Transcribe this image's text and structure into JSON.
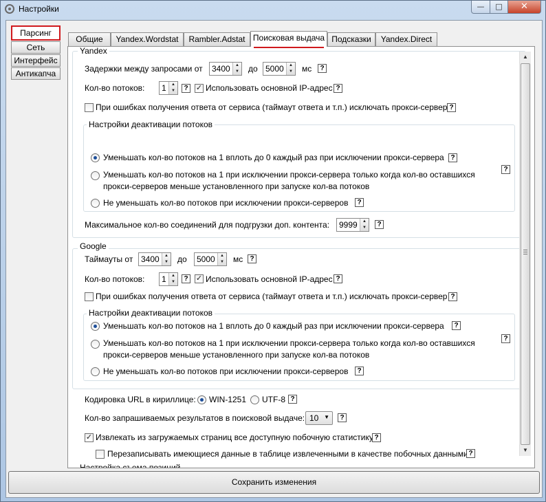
{
  "window": {
    "title": "Настройки",
    "minimize": "—",
    "maximize": "□",
    "close": "✕"
  },
  "left_tabs": [
    "Парсинг",
    "Сеть",
    "Интерфейс",
    "Антикапча"
  ],
  "tabs": [
    "Общие",
    "Yandex.Wordstat",
    "Rambler.Adstat",
    "Поисковая выдача",
    "Подсказки",
    "Yandex.Direct"
  ],
  "help": "?",
  "yandex": {
    "group_title": "Yandex",
    "delay_label": "Задержки между запросами от",
    "delay_from": "3400",
    "to_label": "до",
    "delay_to": "5000",
    "ms_label": "мс",
    "threads_label": "Кол-во потоков:",
    "threads": "1",
    "use_main_ip": "Использовать основной IP-адрес",
    "exclude_proxy": "При ошибках получения ответа от сервиса (таймаут ответа и т.п.) исключать прокси-сервер",
    "deact_title": "Настройки деактивации потоков",
    "opt1": "Уменьшать кол-во потоков на 1 вплоть до 0 каждый раз при исключении прокси-сервера",
    "opt2_line1": "Уменьшать кол-во потоков на 1 при исключении прокси-сервера только когда кол-во оставшихся",
    "opt2_line2": "прокси-серверов меньше установленного при запуске кол-ва потоков",
    "opt3": "Не уменьшать кол-во потоков при исключении прокси-серверов",
    "max_conn_label": "Максимальное кол-во соединений для подгрузки доп. контента:",
    "max_conn": "9999"
  },
  "google": {
    "group_title": "Google",
    "timeout_label": "Таймауты от",
    "timeout_from": "3400",
    "to_label": "до",
    "timeout_to": "5000",
    "ms_label": "мс",
    "threads_label": "Кол-во потоков:",
    "threads": "1",
    "use_main_ip": "Использовать основной IP-адрес",
    "exclude_proxy": "При ошибках получения ответа от сервиса (таймаут ответа и т.п.) исключать прокси-сервер",
    "deact_title": "Настройки деактивации потоков",
    "opt1": "Уменьшать кол-во потоков на 1 вплоть до 0 каждый раз при исключении прокси-сервера",
    "opt2_line1": "Уменьшать кол-во потоков на 1 при исключении прокси-сервера только когда кол-во оставшихся",
    "opt2_line2": "прокси-серверов меньше установленного при запуске кол-ва потоков",
    "opt3": "Не уменьшать кол-во потоков при исключении прокси-серверов"
  },
  "encoding_label": "Кодировка URL в кириллице:",
  "enc_win": "WIN-1251",
  "enc_utf": "UTF-8",
  "results_label": "Кол-во запрашиваемых результатов в поисковой выдаче:",
  "results_value": "10",
  "extract_stats": "Извлекать из загружаемых страниц все доступную побочную статистику",
  "overwrite": "Перезаписывать имеющиеся данные в таблице извлеченными в качестве побочных данными",
  "positions_title": "Настройка съема позиций",
  "save_button": "Сохранить изменения"
}
